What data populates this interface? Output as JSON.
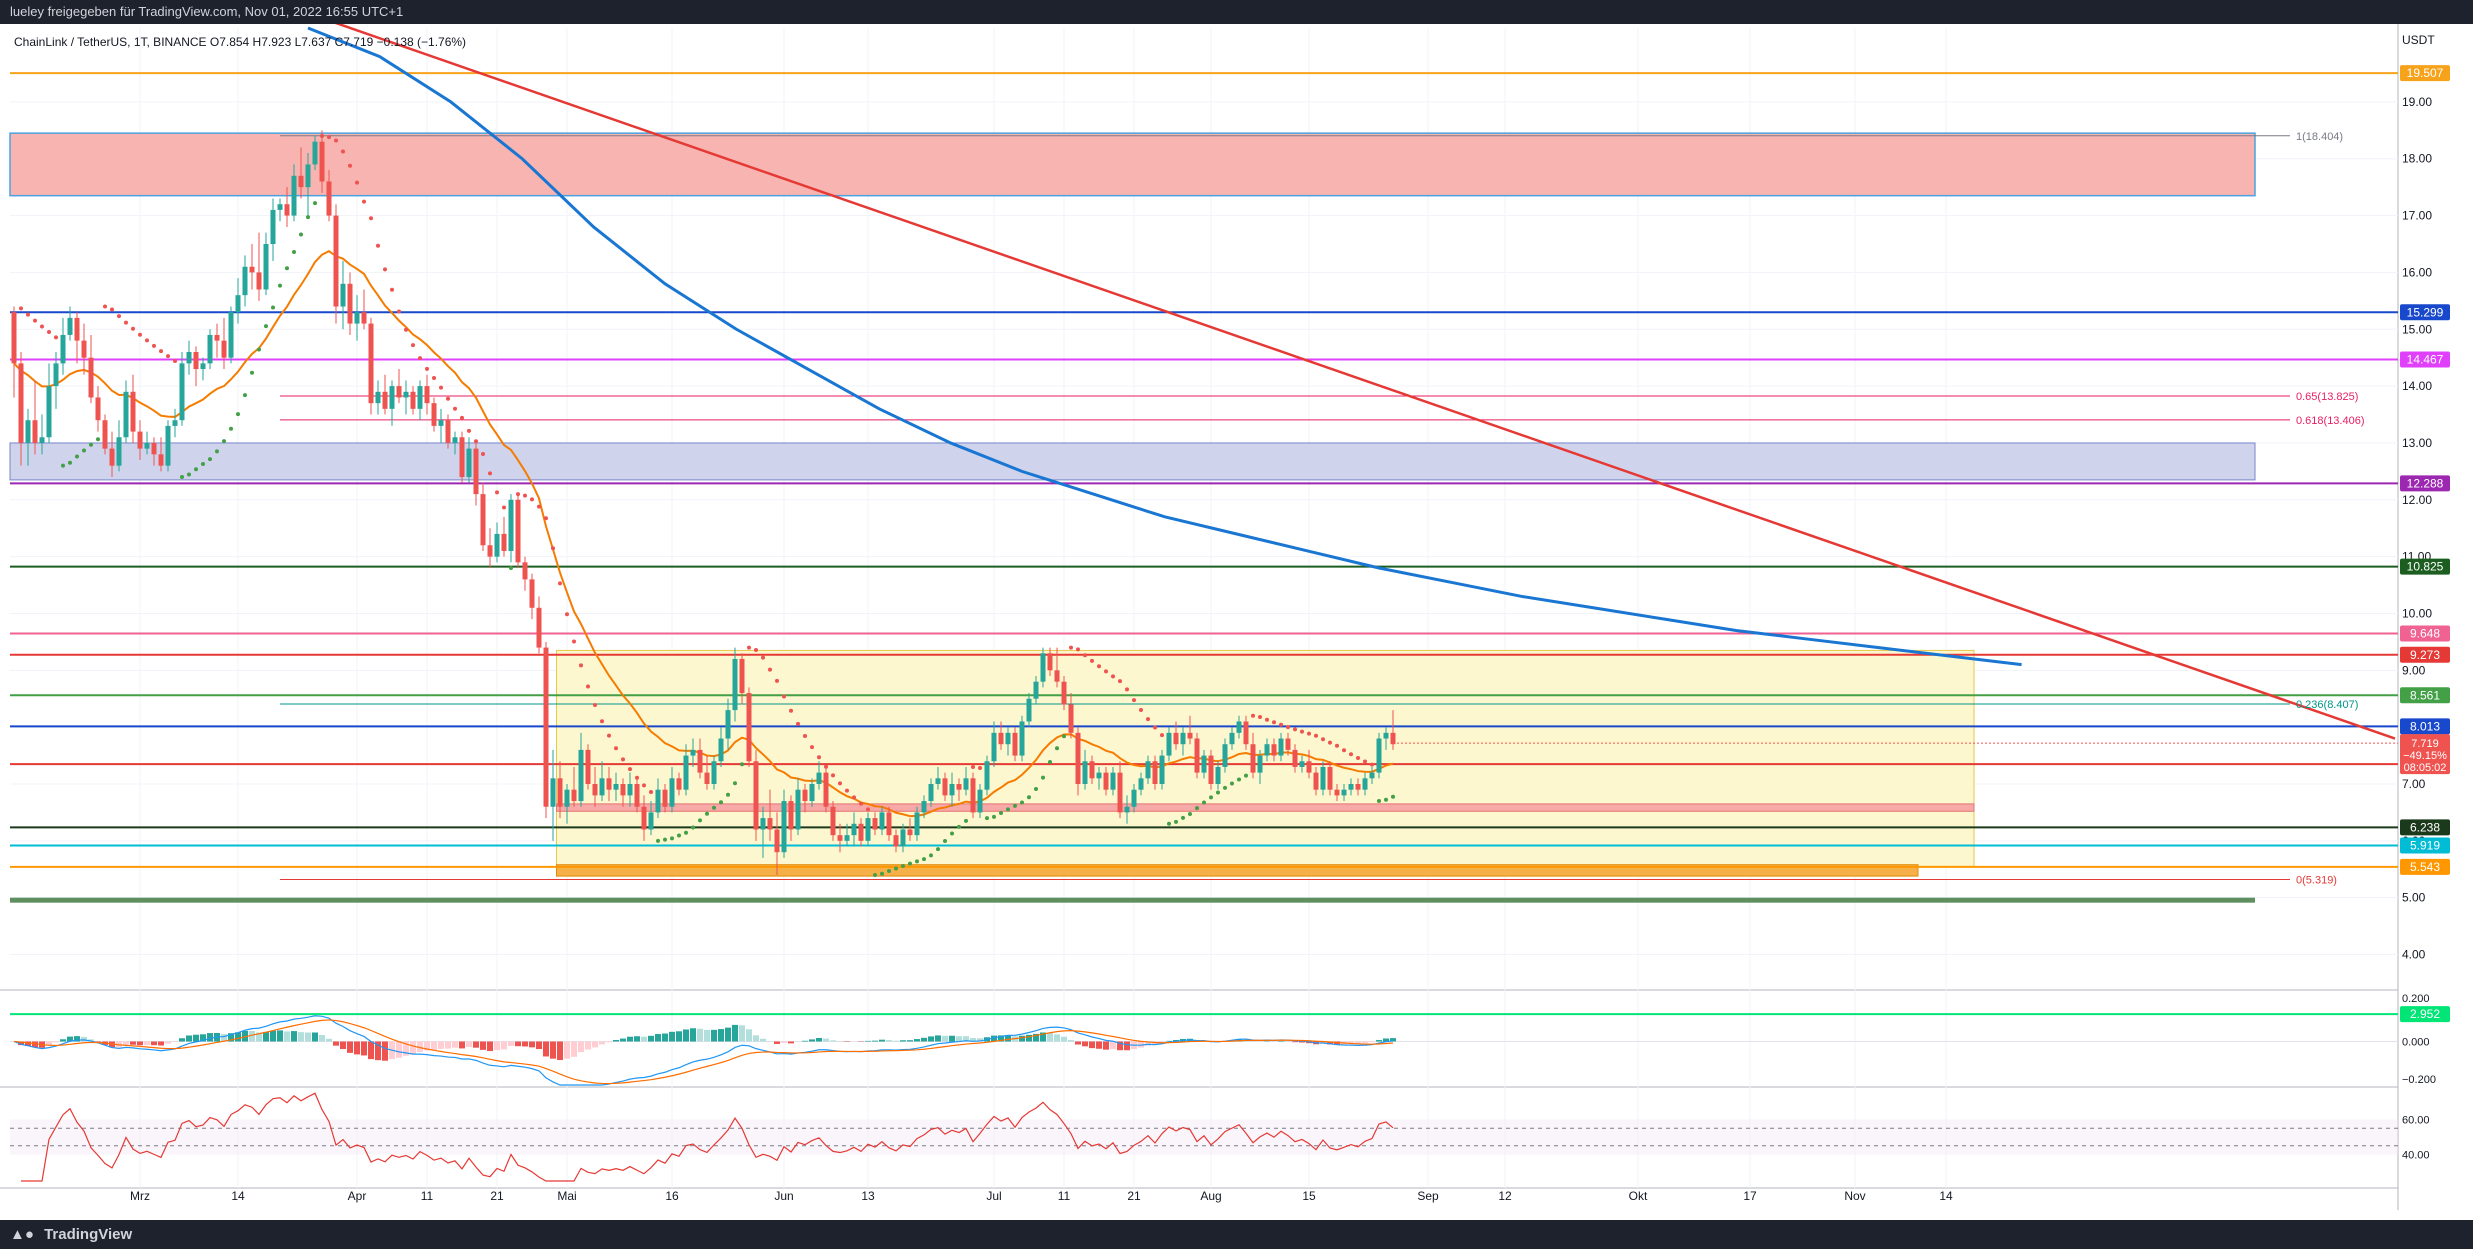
{
  "header": {
    "text": "lueley freigegeben für TradingView.com, Nov 01, 2022 16:55 UTC+1"
  },
  "footer": {
    "brand": "TradingView",
    "logo_icon": "tradingview-logo-icon"
  },
  "chart_data": {
    "type": "candlestick",
    "legend": "ChainLink / TetherUS, 1T, BINANCE  O7.854  H7.923  L7.637  C7.719  −0.138 (−1.76%)",
    "currency_label": "USDT",
    "ylim": [
      3.2,
      20.3
    ],
    "y_ticks": [
      4.0,
      5.0,
      6.0,
      7.0,
      8.0,
      9.0,
      10.0,
      11.0,
      12.0,
      13.0,
      14.0,
      15.0,
      16.0,
      17.0,
      18.0,
      19.0
    ],
    "x_ticks": [
      {
        "label": "Mrz",
        "day": 18
      },
      {
        "label": "14",
        "day": 32
      },
      {
        "label": "Apr",
        "day": 49
      },
      {
        "label": "11",
        "day": 59
      },
      {
        "label": "21",
        "day": 69
      },
      {
        "label": "Mai",
        "day": 79
      },
      {
        "label": "16",
        "day": 94
      },
      {
        "label": "Jun",
        "day": 110
      },
      {
        "label": "13",
        "day": 122
      },
      {
        "label": "Jul",
        "day": 140
      },
      {
        "label": "11",
        "day": 150
      },
      {
        "label": "21",
        "day": 160
      },
      {
        "label": "Aug",
        "day": 171
      },
      {
        "label": "15",
        "day": 185
      },
      {
        "label": "Sep",
        "day": 202
      },
      {
        "label": "12",
        "day": 213
      },
      {
        "label": "Okt",
        "day": 232
      },
      {
        "label": "17",
        "day": 248
      },
      {
        "label": "Nov",
        "day": 263
      },
      {
        "label": "14",
        "day": 276
      }
    ],
    "candles": [
      [
        15.3,
        15.4,
        13.8,
        14.4
      ],
      [
        14.4,
        14.6,
        12.6,
        13.0
      ],
      [
        13.0,
        13.6,
        12.6,
        13.4
      ],
      [
        13.4,
        14.1,
        12.8,
        13.0
      ],
      [
        13.0,
        13.5,
        12.8,
        13.1
      ],
      [
        13.1,
        14.4,
        13.0,
        14.0
      ],
      [
        14.0,
        14.6,
        13.6,
        14.4
      ],
      [
        14.4,
        15.2,
        14.2,
        14.9
      ],
      [
        14.9,
        15.4,
        14.8,
        15.2
      ],
      [
        15.2,
        15.3,
        14.4,
        14.8
      ],
      [
        14.8,
        15.1,
        14.2,
        14.5
      ],
      [
        14.5,
        14.9,
        13.7,
        13.8
      ],
      [
        13.8,
        14.0,
        13.2,
        13.4
      ],
      [
        13.4,
        13.5,
        12.8,
        12.9
      ],
      [
        12.9,
        13.2,
        12.4,
        12.6
      ],
      [
        12.6,
        13.4,
        12.5,
        13.1
      ],
      [
        13.1,
        14.1,
        13.0,
        13.9
      ],
      [
        13.9,
        14.2,
        13.0,
        13.2
      ],
      [
        13.2,
        13.4,
        12.7,
        12.9
      ],
      [
        12.9,
        13.2,
        12.8,
        13.0
      ],
      [
        13.0,
        13.1,
        12.6,
        12.8
      ],
      [
        12.8,
        13.1,
        12.5,
        12.6
      ],
      [
        12.6,
        13.4,
        12.5,
        13.3
      ],
      [
        13.3,
        13.6,
        13.1,
        13.4
      ],
      [
        13.4,
        14.6,
        13.3,
        14.4
      ],
      [
        14.4,
        14.8,
        14.2,
        14.6
      ],
      [
        14.6,
        14.7,
        14.0,
        14.3
      ],
      [
        14.3,
        14.5,
        14.1,
        14.4
      ],
      [
        14.4,
        15.0,
        14.3,
        14.9
      ],
      [
        14.9,
        15.1,
        14.5,
        14.8
      ],
      [
        14.8,
        15.2,
        14.3,
        14.5
      ],
      [
        14.5,
        15.4,
        14.4,
        15.3
      ],
      [
        15.3,
        15.9,
        15.1,
        15.6
      ],
      [
        15.6,
        16.3,
        15.4,
        16.1
      ],
      [
        16.1,
        16.5,
        15.7,
        16.0
      ],
      [
        16.0,
        16.7,
        15.5,
        15.7
      ],
      [
        15.7,
        16.7,
        15.6,
        16.5
      ],
      [
        16.5,
        17.3,
        16.2,
        17.1
      ],
      [
        17.1,
        17.3,
        16.9,
        17.2
      ],
      [
        17.2,
        17.5,
        16.8,
        17.0
      ],
      [
        17.0,
        17.9,
        16.9,
        17.7
      ],
      [
        17.7,
        18.2,
        17.3,
        17.5
      ],
      [
        17.5,
        18.1,
        17.0,
        17.9
      ],
      [
        17.9,
        18.4,
        17.8,
        18.3
      ],
      [
        18.3,
        18.5,
        17.4,
        17.6
      ],
      [
        17.6,
        17.8,
        16.9,
        17.0
      ],
      [
        17.0,
        17.2,
        15.1,
        15.4
      ],
      [
        15.4,
        16.2,
        15.0,
        15.8
      ],
      [
        15.8,
        16.0,
        14.9,
        15.1
      ],
      [
        15.1,
        15.6,
        14.8,
        15.3
      ],
      [
        15.3,
        15.7,
        15.0,
        15.1
      ],
      [
        15.1,
        15.2,
        13.5,
        13.7
      ],
      [
        13.7,
        14.1,
        13.5,
        13.9
      ],
      [
        13.9,
        14.2,
        13.5,
        13.6
      ],
      [
        13.6,
        14.1,
        13.3,
        14.0
      ],
      [
        14.0,
        14.3,
        13.7,
        13.8
      ],
      [
        13.8,
        14.1,
        13.5,
        13.9
      ],
      [
        13.9,
        14.0,
        13.5,
        13.6
      ],
      [
        13.6,
        14.1,
        13.4,
        14.0
      ],
      [
        14.0,
        14.2,
        13.5,
        13.7
      ],
      [
        13.7,
        13.8,
        13.2,
        13.3
      ],
      [
        13.3,
        13.6,
        13.0,
        13.4
      ],
      [
        13.4,
        13.5,
        12.9,
        13.0
      ],
      [
        13.0,
        13.2,
        12.8,
        13.1
      ],
      [
        13.1,
        13.2,
        12.3,
        12.4
      ],
      [
        12.4,
        13.1,
        12.3,
        12.9
      ],
      [
        12.9,
        13.0,
        11.9,
        12.1
      ],
      [
        12.1,
        12.3,
        11.1,
        11.2
      ],
      [
        11.2,
        11.5,
        10.8,
        11.0
      ],
      [
        11.0,
        11.6,
        10.9,
        11.4
      ],
      [
        11.4,
        11.7,
        11.0,
        11.1
      ],
      [
        11.1,
        12.1,
        10.9,
        12.0
      ],
      [
        12.0,
        12.1,
        10.8,
        10.9
      ],
      [
        10.9,
        11.0,
        10.4,
        10.6
      ],
      [
        10.6,
        10.7,
        9.9,
        10.1
      ],
      [
        10.1,
        10.3,
        9.3,
        9.4
      ],
      [
        9.4,
        9.5,
        6.4,
        6.6
      ],
      [
        6.6,
        7.6,
        6.0,
        7.1
      ],
      [
        7.1,
        7.4,
        6.4,
        6.6
      ],
      [
        6.6,
        7.0,
        6.3,
        6.9
      ],
      [
        6.9,
        7.3,
        6.6,
        6.7
      ],
      [
        6.7,
        7.9,
        6.6,
        7.6
      ],
      [
        7.6,
        7.7,
        6.9,
        7.0
      ],
      [
        7.0,
        7.3,
        6.6,
        6.8
      ],
      [
        6.8,
        7.4,
        6.7,
        7.1
      ],
      [
        7.1,
        7.3,
        6.7,
        6.9
      ],
      [
        6.9,
        7.2,
        6.7,
        7.0
      ],
      [
        7.0,
        7.1,
        6.6,
        6.8
      ],
      [
        6.8,
        7.2,
        6.6,
        7.0
      ],
      [
        7.0,
        7.1,
        6.5,
        6.6
      ],
      [
        6.6,
        6.8,
        6.0,
        6.2
      ],
      [
        6.2,
        6.7,
        6.1,
        6.5
      ],
      [
        6.5,
        7.1,
        6.4,
        6.9
      ],
      [
        6.9,
        7.0,
        6.5,
        6.6
      ],
      [
        6.6,
        7.3,
        6.5,
        7.1
      ],
      [
        7.1,
        7.2,
        6.8,
        6.9
      ],
      [
        6.9,
        7.7,
        6.8,
        7.5
      ],
      [
        7.5,
        7.8,
        7.3,
        7.6
      ],
      [
        7.6,
        7.8,
        7.1,
        7.2
      ],
      [
        7.2,
        7.5,
        6.9,
        7.0
      ],
      [
        7.0,
        7.5,
        6.9,
        7.4
      ],
      [
        7.4,
        8.0,
        7.3,
        7.8
      ],
      [
        7.8,
        8.5,
        7.6,
        8.3
      ],
      [
        8.3,
        9.4,
        8.1,
        9.2
      ],
      [
        9.2,
        9.3,
        8.4,
        8.6
      ],
      [
        8.6,
        8.7,
        7.3,
        7.4
      ],
      [
        7.4,
        7.6,
        6.0,
        6.2
      ],
      [
        6.2,
        6.6,
        5.7,
        6.4
      ],
      [
        6.4,
        6.9,
        6.0,
        6.2
      ],
      [
        6.2,
        6.5,
        5.4,
        5.8
      ],
      [
        5.8,
        6.9,
        5.7,
        6.7
      ],
      [
        6.7,
        6.8,
        6.0,
        6.2
      ],
      [
        6.2,
        7.1,
        6.1,
        6.9
      ],
      [
        6.9,
        7.0,
        6.5,
        6.7
      ],
      [
        6.7,
        7.1,
        6.6,
        7.0
      ],
      [
        7.0,
        7.4,
        6.9,
        7.2
      ],
      [
        7.2,
        7.3,
        6.5,
        6.6
      ],
      [
        6.6,
        6.7,
        6.0,
        6.1
      ],
      [
        6.1,
        6.3,
        5.8,
        6.0
      ],
      [
        6.0,
        6.3,
        5.9,
        6.1
      ],
      [
        6.1,
        6.5,
        5.9,
        6.3
      ],
      [
        6.3,
        6.4,
        5.9,
        6.0
      ],
      [
        6.0,
        6.5,
        5.9,
        6.4
      ],
      [
        6.4,
        6.5,
        6.1,
        6.2
      ],
      [
        6.2,
        6.6,
        6.1,
        6.5
      ],
      [
        6.5,
        6.6,
        6.0,
        6.1
      ],
      [
        6.1,
        6.2,
        5.8,
        5.9
      ],
      [
        5.9,
        6.3,
        5.8,
        6.2
      ],
      [
        6.2,
        6.4,
        6.0,
        6.1
      ],
      [
        6.1,
        6.6,
        6.0,
        6.5
      ],
      [
        6.5,
        6.8,
        6.4,
        6.7
      ],
      [
        6.7,
        7.1,
        6.6,
        7.0
      ],
      [
        7.0,
        7.3,
        6.9,
        7.1
      ],
      [
        7.1,
        7.2,
        6.7,
        6.8
      ],
      [
        6.8,
        7.2,
        6.6,
        7.0
      ],
      [
        7.0,
        7.1,
        6.7,
        6.9
      ],
      [
        6.9,
        7.3,
        6.8,
        7.1
      ],
      [
        7.1,
        7.2,
        6.4,
        6.5
      ],
      [
        6.5,
        7.0,
        6.4,
        6.9
      ],
      [
        6.9,
        7.5,
        6.8,
        7.4
      ],
      [
        7.4,
        8.1,
        7.3,
        7.9
      ],
      [
        7.9,
        8.1,
        7.6,
        7.7
      ],
      [
        7.7,
        8.0,
        7.5,
        7.9
      ],
      [
        7.9,
        8.0,
        7.4,
        7.5
      ],
      [
        7.5,
        8.2,
        7.4,
        8.1
      ],
      [
        8.1,
        8.6,
        8.0,
        8.5
      ],
      [
        8.5,
        8.9,
        8.4,
        8.8
      ],
      [
        8.8,
        9.4,
        8.7,
        9.3
      ],
      [
        9.3,
        9.4,
        8.9,
        9.0
      ],
      [
        9.0,
        9.4,
        8.7,
        8.8
      ],
      [
        8.8,
        8.9,
        8.3,
        8.4
      ],
      [
        8.4,
        8.6,
        7.8,
        7.9
      ],
      [
        7.9,
        8.0,
        6.8,
        7.0
      ],
      [
        7.0,
        7.6,
        6.9,
        7.4
      ],
      [
        7.4,
        7.5,
        7.0,
        7.1
      ],
      [
        7.1,
        7.3,
        6.9,
        7.2
      ],
      [
        7.2,
        7.3,
        6.8,
        6.9
      ],
      [
        6.9,
        7.3,
        6.8,
        7.2
      ],
      [
        7.2,
        7.4,
        6.4,
        6.5
      ],
      [
        6.5,
        6.8,
        6.3,
        6.6
      ],
      [
        6.6,
        7.0,
        6.5,
        6.9
      ],
      [
        6.9,
        7.2,
        6.8,
        7.1
      ],
      [
        7.1,
        7.5,
        7.0,
        7.4
      ],
      [
        7.4,
        7.5,
        6.9,
        7.0
      ],
      [
        7.0,
        7.6,
        6.9,
        7.5
      ],
      [
        7.5,
        8.0,
        7.4,
        7.9
      ],
      [
        7.9,
        8.1,
        7.6,
        7.7
      ],
      [
        7.7,
        8.0,
        7.5,
        7.9
      ],
      [
        7.9,
        8.2,
        7.7,
        7.8
      ],
      [
        7.8,
        7.9,
        7.1,
        7.2
      ],
      [
        7.2,
        7.6,
        7.1,
        7.5
      ],
      [
        7.5,
        7.6,
        6.9,
        7.0
      ],
      [
        7.0,
        7.4,
        6.9,
        7.3
      ],
      [
        7.3,
        7.8,
        7.2,
        7.7
      ],
      [
        7.7,
        8.0,
        7.6,
        7.9
      ],
      [
        7.9,
        8.2,
        7.8,
        8.1
      ],
      [
        8.1,
        8.2,
        7.6,
        7.7
      ],
      [
        7.7,
        7.9,
        7.1,
        7.2
      ],
      [
        7.2,
        7.6,
        7.0,
        7.5
      ],
      [
        7.5,
        7.8,
        7.4,
        7.7
      ],
      [
        7.7,
        7.8,
        7.4,
        7.5
      ],
      [
        7.5,
        7.9,
        7.4,
        7.8
      ],
      [
        7.8,
        7.9,
        7.5,
        7.6
      ],
      [
        7.6,
        7.7,
        7.2,
        7.3
      ],
      [
        7.3,
        7.5,
        7.2,
        7.4
      ],
      [
        7.4,
        7.6,
        7.1,
        7.2
      ],
      [
        7.2,
        7.3,
        6.8,
        6.9
      ],
      [
        6.9,
        7.4,
        6.8,
        7.3
      ],
      [
        7.3,
        7.4,
        6.8,
        6.9
      ],
      [
        6.9,
        7.0,
        6.7,
        6.8
      ],
      [
        6.8,
        7.0,
        6.7,
        6.9
      ],
      [
        6.9,
        7.1,
        6.8,
        7.0
      ],
      [
        7.0,
        7.1,
        6.8,
        6.9
      ],
      [
        6.9,
        7.2,
        6.8,
        7.1
      ],
      [
        7.1,
        7.3,
        7.0,
        7.2
      ],
      [
        7.2,
        7.9,
        7.1,
        7.8
      ],
      [
        7.8,
        8.0,
        7.6,
        7.9
      ],
      [
        7.9,
        8.3,
        7.6,
        7.7
      ]
    ],
    "indicators": {
      "ema_orange_period_label": "",
      "sma_blue_label": ""
    },
    "horizontal_levels": [
      {
        "price": "19.507",
        "color": "#f7a21b"
      },
      {
        "price": "15.299",
        "color": "#1848cc"
      },
      {
        "price": "14.467",
        "color": "#e040fb"
      },
      {
        "price": "12.288",
        "color": "#9c27b0"
      },
      {
        "price": "10.825",
        "color": "#1b5e20"
      },
      {
        "price": "9.648",
        "color": "#f06292"
      },
      {
        "price": "9.273",
        "color": "#e53935"
      },
      {
        "price": "8.561",
        "color": "#43a047"
      },
      {
        "price": "8.013",
        "color": "#1848cc"
      },
      {
        "price": "7.350",
        "color": "#e53935"
      },
      {
        "price": "6.238",
        "color": "#1b3a1b"
      },
      {
        "price": "5.919",
        "color": "#00bcd4"
      },
      {
        "price": "5.543",
        "color": "#ff9800"
      },
      {
        "price": "2.952",
        "color": "#00e676"
      }
    ],
    "fib_labels": [
      {
        "text": "1(18.404)",
        "price": 18.404
      },
      {
        "text": "0.65(13.825)",
        "price": 13.825
      },
      {
        "text": "0.618(13.406)",
        "price": 13.406
      },
      {
        "text": "0.236(8.407)",
        "price": 8.407
      },
      {
        "text": "0(5.319)",
        "price": 5.319
      }
    ],
    "last_price": {
      "value": "7.719",
      "change": "−49.15%",
      "countdown": "08:05:02"
    },
    "macd_ticks": [
      "0.200",
      "0.000",
      "−0.200"
    ],
    "rsi_ticks": [
      "60.00",
      "40.00"
    ]
  }
}
